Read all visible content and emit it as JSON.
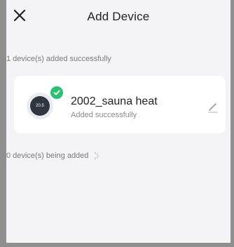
{
  "header": {
    "title": "Add Device",
    "close_icon": "close-icon"
  },
  "added_section": {
    "label": "1 device(s) added successfully"
  },
  "device": {
    "name": "2002_sauna heat",
    "status": "Added successfully",
    "thumb_reading": "20.5",
    "status_color": "#2bc170",
    "edit_icon": "pencil-icon"
  },
  "adding_section": {
    "label": "0 device(s) being added",
    "spinner_icon": "loading-spinner-icon"
  }
}
